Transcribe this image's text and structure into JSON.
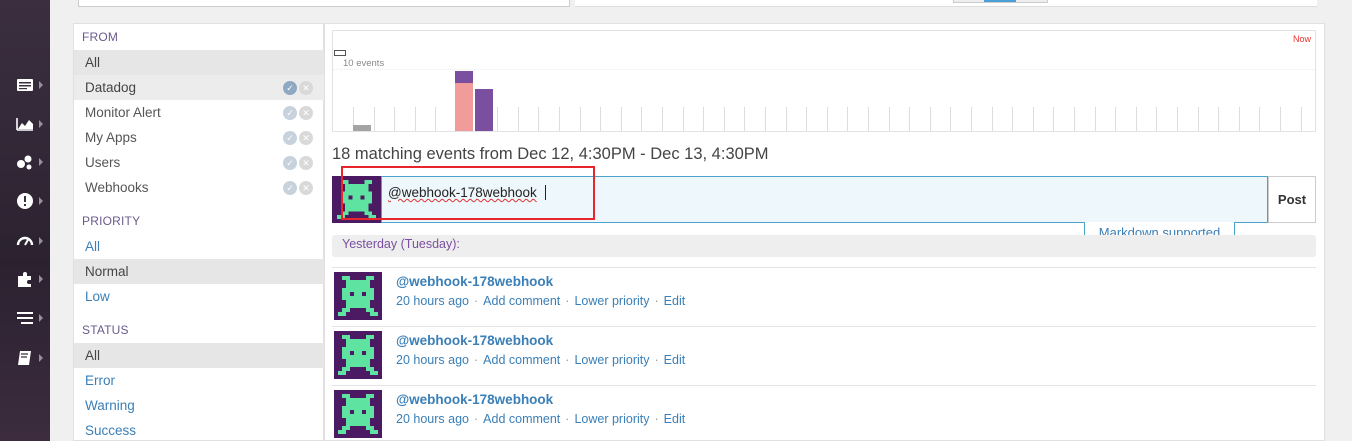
{
  "nav": {
    "icons": [
      "events-icon",
      "metrics-icon",
      "infrastructure-icon",
      "monitors-icon",
      "dashboards-icon",
      "integrations-icon",
      "logs-icon",
      "notebooks-icon"
    ]
  },
  "filters": {
    "from": {
      "title": "FROM",
      "items": [
        {
          "label": "All",
          "selected": true
        },
        {
          "label": "Datadog",
          "selected": true
        },
        {
          "label": "Monitor Alert"
        },
        {
          "label": "My Apps"
        },
        {
          "label": "Users"
        },
        {
          "label": "Webhooks"
        }
      ]
    },
    "priority": {
      "title": "PRIORITY",
      "items": [
        {
          "label": "All"
        },
        {
          "label": "Normal",
          "selected": true
        },
        {
          "label": "Low"
        }
      ]
    },
    "status": {
      "title": "STATUS",
      "items": [
        {
          "label": "All",
          "selected": true
        },
        {
          "label": "Error"
        },
        {
          "label": "Warning"
        },
        {
          "label": "Success"
        }
      ]
    }
  },
  "chart": {
    "now_label": "Now",
    "events_label": "10 events",
    "colors": {
      "normal": "#a4a4a4",
      "alert": "#f29b9b",
      "info": "#7a4fa0"
    }
  },
  "summary": "18 matching events from Dec 12, 4:30PM - Dec 13, 4:30PM",
  "post": {
    "input_value": "@webhook-178webhook",
    "button_label": "Post",
    "markdown_tip": "Markdown supported"
  },
  "day_header": "Yesterday (Tuesday):",
  "events": [
    {
      "title": "@webhook-178webhook",
      "time": "20 hours ago",
      "actions": [
        "Add comment",
        "Lower priority",
        "Edit"
      ]
    },
    {
      "title": "@webhook-178webhook",
      "time": "20 hours ago",
      "actions": [
        "Add comment",
        "Lower priority",
        "Edit"
      ]
    },
    {
      "title": "@webhook-178webhook",
      "time": "20 hours ago",
      "actions": [
        "Add comment",
        "Lower priority",
        "Edit"
      ]
    }
  ],
  "colors": {
    "accent": "#3a7fb7",
    "section": "#6a5a8c",
    "avatar_bg": "#4b1a63",
    "avatar_fg": "#5fe3a1",
    "highlight": "#e8252a"
  }
}
